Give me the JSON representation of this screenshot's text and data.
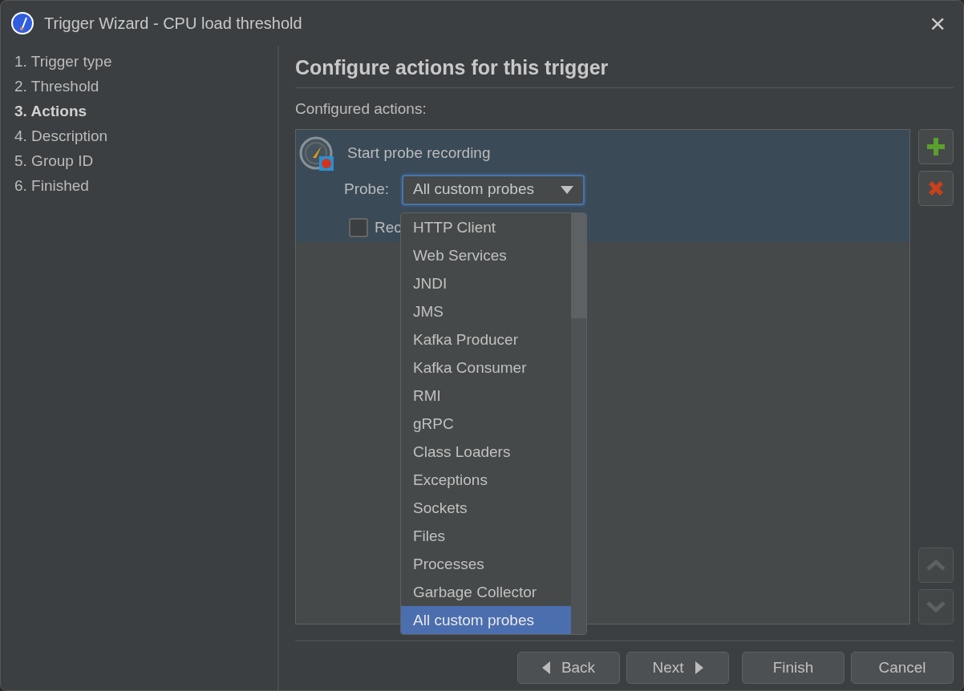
{
  "window": {
    "title": "Trigger Wizard - CPU load threshold",
    "close": "×"
  },
  "steps": [
    {
      "label": "1. Trigger type",
      "selected": false
    },
    {
      "label": "2. Threshold",
      "selected": false
    },
    {
      "label": "3. Actions",
      "selected": true
    },
    {
      "label": "4. Description",
      "selected": false
    },
    {
      "label": "5. Group ID",
      "selected": false
    },
    {
      "label": "6. Finished",
      "selected": false
    }
  ],
  "heading": "Configure actions for this trigger",
  "actions_label": "Configured actions:",
  "actions": [
    {
      "title": "Start probe recording",
      "selected": true,
      "probe_label": "Probe:",
      "probe_value": "All custom probes",
      "checkbox": {
        "label": "Rec",
        "checked": false
      }
    }
  ],
  "dropdown": {
    "items": [
      {
        "label": "HTTP Client",
        "selected": false
      },
      {
        "label": "Web Services",
        "selected": false
      },
      {
        "label": "JNDI",
        "selected": false
      },
      {
        "label": "JMS",
        "selected": false
      },
      {
        "label": "Kafka Producer",
        "selected": false
      },
      {
        "label": "Kafka Consumer",
        "selected": false
      },
      {
        "label": "RMI",
        "selected": false
      },
      {
        "label": "gRPC",
        "selected": false
      },
      {
        "label": "Class Loaders",
        "selected": false
      },
      {
        "label": "Exceptions",
        "selected": false
      },
      {
        "label": "Sockets",
        "selected": false
      },
      {
        "label": "Files",
        "selected": false
      },
      {
        "label": "Processes",
        "selected": false
      },
      {
        "label": "Garbage Collector",
        "selected": false
      },
      {
        "label": "All custom probes",
        "selected": true
      }
    ]
  },
  "side_buttons": [
    {
      "kind": "add",
      "disabled": false
    },
    {
      "kind": "remove",
      "disabled": false
    },
    {
      "kind": "up",
      "disabled": true
    },
    {
      "kind": "down",
      "disabled": true
    }
  ],
  "buttons": [
    {
      "kind": "back",
      "label": "Back"
    },
    {
      "kind": "next",
      "label": "Next"
    },
    {
      "kind": "finish",
      "label": "Finish"
    },
    {
      "kind": "cancel",
      "label": "Cancel"
    }
  ]
}
